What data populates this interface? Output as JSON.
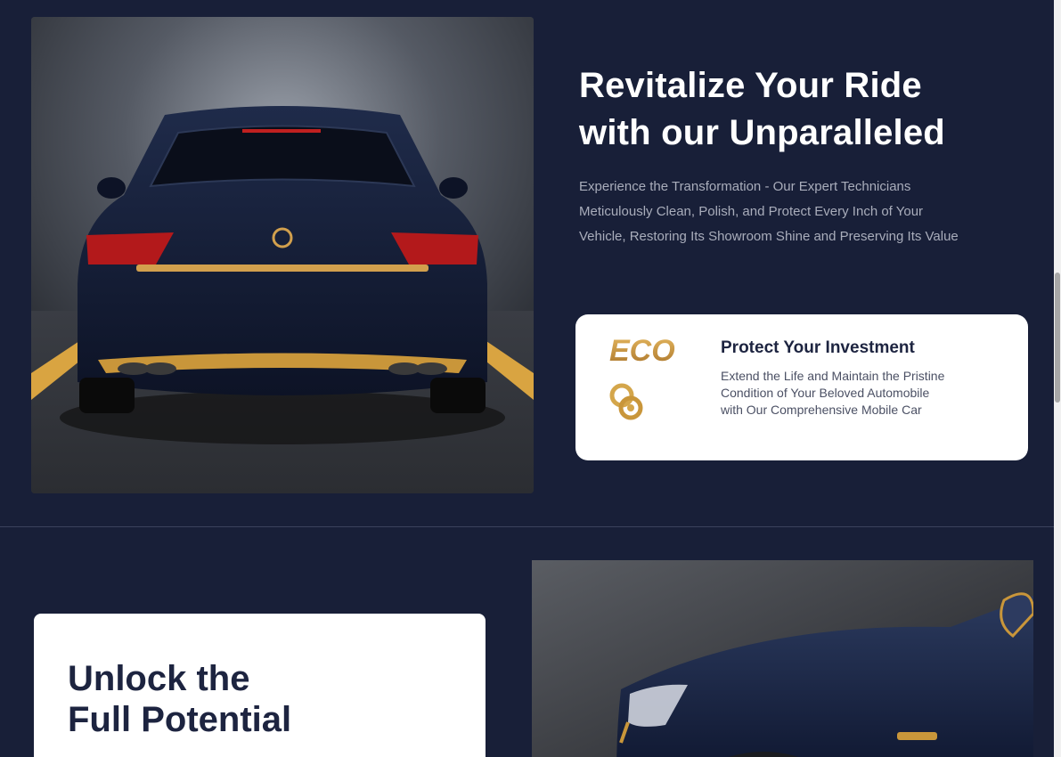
{
  "hero": {
    "title_line1": "Revitalize Your Ride",
    "title_line2": "with our Unparalleled",
    "description_line1": "Experience the Transformation - Our Expert Technicians",
    "description_line2": "Meticulously Clean, Polish, and Protect Every Inch of Your",
    "description_line3": "Vehicle, Restoring Its Showroom Shine and Preserving Its Value"
  },
  "invest_card": {
    "logo_text": "ECO",
    "title": "Protect Your Investment",
    "text_line1": "Extend the Life and Maintain the Pristine",
    "text_line2": "Condition of Your Beloved Automobile",
    "text_line3": "with Our Comprehensive Mobile Car"
  },
  "unlock": {
    "title_line1": "Unlock the",
    "title_line2": "Full Potential"
  },
  "colors": {
    "background": "#181f38",
    "accent_gold": "#c9963a",
    "card": "#ffffff",
    "heading_dark": "#1d2440"
  },
  "icons": [
    "eco-logo",
    "gold-emblem-icon"
  ]
}
